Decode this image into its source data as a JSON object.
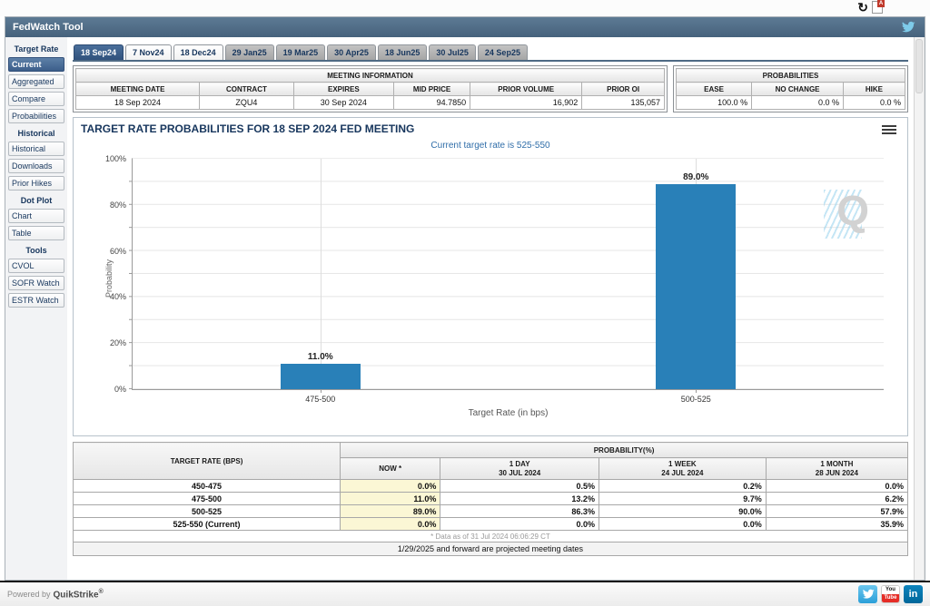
{
  "window": {
    "refresh_icon": "↻",
    "export_letter": "A"
  },
  "titlebar": {
    "title": "FedWatch Tool"
  },
  "tabs": [
    {
      "label": "18 Sep24",
      "state": "selected"
    },
    {
      "label": "7 Nov24",
      "state": "light"
    },
    {
      "label": "18 Dec24",
      "state": "light"
    },
    {
      "label": "29 Jan25",
      "state": "gray"
    },
    {
      "label": "19 Mar25",
      "state": "gray"
    },
    {
      "label": "30 Apr25",
      "state": "gray"
    },
    {
      "label": "18 Jun25",
      "state": "gray"
    },
    {
      "label": "30 Jul25",
      "state": "gray"
    },
    {
      "label": "24 Sep25",
      "state": "gray"
    }
  ],
  "sidebar": {
    "sections": [
      {
        "header": "Target Rate",
        "items": [
          {
            "label": "Current",
            "selected": true
          },
          {
            "label": "Aggregated",
            "selected": false
          },
          {
            "label": "Compare",
            "selected": false
          },
          {
            "label": "Probabilities",
            "selected": false
          }
        ]
      },
      {
        "header": "Historical",
        "items": [
          {
            "label": "Historical",
            "selected": false
          },
          {
            "label": "Downloads",
            "selected": false
          },
          {
            "label": "Prior Hikes",
            "selected": false
          }
        ]
      },
      {
        "header": "Dot Plot",
        "items": [
          {
            "label": "Chart",
            "selected": false
          },
          {
            "label": "Table",
            "selected": false
          }
        ]
      },
      {
        "header": "Tools",
        "items": [
          {
            "label": "CVOL",
            "selected": false
          },
          {
            "label": "SOFR Watch",
            "selected": false
          },
          {
            "label": "ESTR Watch",
            "selected": false
          }
        ]
      }
    ]
  },
  "meeting_info": {
    "title": "MEETING INFORMATION",
    "columns": [
      "MEETING DATE",
      "CONTRACT",
      "EXPIRES",
      "MID PRICE",
      "PRIOR VOLUME",
      "PRIOR OI"
    ],
    "values": [
      "18 Sep 2024",
      "ZQU4",
      "30 Sep 2024",
      "94.7850",
      "16,902",
      "135,057"
    ]
  },
  "probabilities_box": {
    "title": "PROBABILITIES",
    "columns": [
      "EASE",
      "NO CHANGE",
      "HIKE"
    ],
    "values": [
      "100.0 %",
      "0.0 %",
      "0.0 %"
    ]
  },
  "chart_data": {
    "type": "bar",
    "title": "TARGET RATE PROBABILITIES FOR 18 SEP 2024 FED MEETING",
    "subtitle": "Current target rate is 525-550",
    "categories": [
      "475-500",
      "500-525"
    ],
    "values": [
      11.0,
      89.0
    ],
    "value_labels": [
      "11.0%",
      "89.0%"
    ],
    "xlabel": "Target Rate (in bps)",
    "ylabel": "Probability",
    "ylim": [
      0,
      100
    ],
    "yticks": [
      "0%",
      "20%",
      "40%",
      "60%",
      "80%",
      "100%"
    ],
    "grid": true,
    "legend": false,
    "bar_color": "#2980b8",
    "watermark": "Q"
  },
  "probability_table": {
    "corner_header": "TARGET RATE (BPS)",
    "group_header": "PROBABILITY(%)",
    "columns": [
      {
        "line1": "NOW *",
        "line2": ""
      },
      {
        "line1": "1 DAY",
        "line2": "30 JUL 2024"
      },
      {
        "line1": "1 WEEK",
        "line2": "24 JUL 2024"
      },
      {
        "line1": "1 MONTH",
        "line2": "28 JUN 2024"
      }
    ],
    "rows": [
      {
        "rate": "450-475",
        "now": "0.0%",
        "day": "0.5%",
        "week": "0.2%",
        "month": "0.0%"
      },
      {
        "rate": "475-500",
        "now": "11.0%",
        "day": "13.2%",
        "week": "9.7%",
        "month": "6.2%"
      },
      {
        "rate": "500-525",
        "now": "89.0%",
        "day": "86.3%",
        "week": "90.0%",
        "month": "57.9%"
      },
      {
        "rate": "525-550 (Current)",
        "now": "0.0%",
        "day": "0.0%",
        "week": "0.0%",
        "month": "35.9%"
      }
    ],
    "footnote": "* Data as of 31 Jul 2024 06:06:29 CT",
    "projected_note": "1/29/2025 and forward are projected meeting dates"
  },
  "footer": {
    "powered_by": "Powered by",
    "brand": "QuikStrike",
    "reg_mark": "®"
  },
  "social": {
    "youtube_top": "You",
    "youtube_bottom": "Tube",
    "linkedin": "in"
  },
  "colors": {
    "accent_blue": "#3c5e8a",
    "bar_blue": "#2980b8",
    "highlight_yellow": "#fbf7d5",
    "titlebar_blue": "#4f6a84",
    "twitter_blue": "#35b6e9",
    "youtube_red": "#e52d27",
    "linkedin_blue": "#0077b5"
  }
}
